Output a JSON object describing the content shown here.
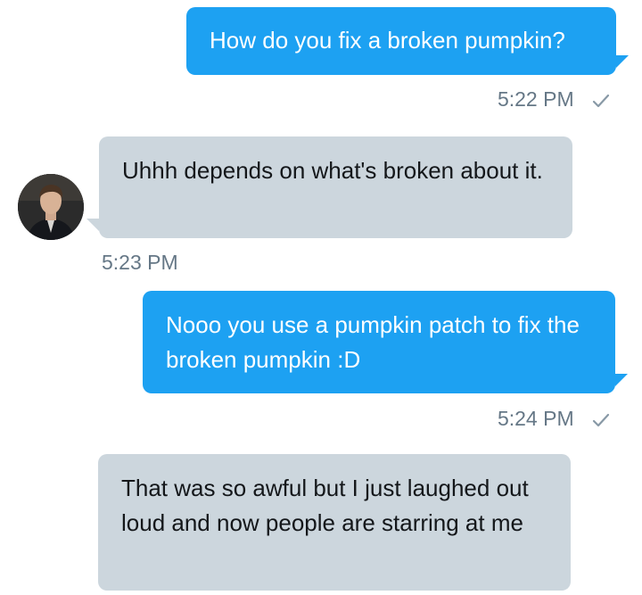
{
  "messages": [
    {
      "direction": "outgoing",
      "text": "How do you fix a broken pumpkin?",
      "time": "5:22 PM",
      "status_icon": "check-icon"
    },
    {
      "direction": "incoming",
      "text": "Uhhh depends on what's broken about it.",
      "time": "5:23 PM",
      "avatar": "avatar"
    },
    {
      "direction": "outgoing",
      "text": "Nooo you use a pumpkin patch to fix the broken pumpkin :D",
      "time": "5:24 PM",
      "status_icon": "check-icon"
    },
    {
      "direction": "incoming",
      "text": "That was so awful but I just laughed out loud and now people are starring at me"
    }
  ],
  "colors": {
    "outgoing_bubble": "#1da1f2",
    "incoming_bubble": "#ccd6dd",
    "outgoing_text": "#ffffff",
    "incoming_text": "#14171a",
    "timestamp": "#657786"
  }
}
